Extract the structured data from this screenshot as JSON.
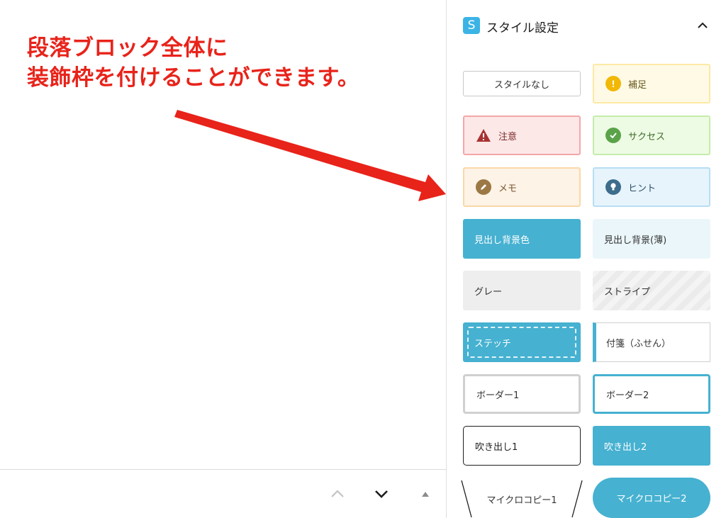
{
  "annotation": {
    "line1": "段落ブロック全体に",
    "line2": "装飾枠を付けることができます。"
  },
  "colors": {
    "annotation": "#e8231a",
    "accent": "#46b1d1",
    "logo": "#3bb4e5"
  },
  "navigation": {
    "move_up_icon": "chevron-up-icon",
    "move_down_icon": "chevron-down-icon",
    "options_icon": "triangle-up-icon"
  },
  "panel": {
    "logo_letter": "S",
    "title": "スタイル設定",
    "toggle_icon": "chevron-up-icon"
  },
  "styles": {
    "none": "スタイルなし",
    "hosoku": "補足",
    "chui": "注意",
    "success": "サクセス",
    "memo": "メモ",
    "hint": "ヒント",
    "head": "見出し背景色",
    "head_light": "見出し背景(薄)",
    "gray": "グレー",
    "stripe": "ストライプ",
    "stitch": "ステッチ",
    "fusen": "付箋（ふせん）",
    "border1": "ボーダー1",
    "border2": "ボーダー2",
    "balloon1": "吹き出し1",
    "balloon2": "吹き出し2",
    "microcopy1": "マイクロコピー1",
    "microcopy2": "マイクロコピー2"
  }
}
